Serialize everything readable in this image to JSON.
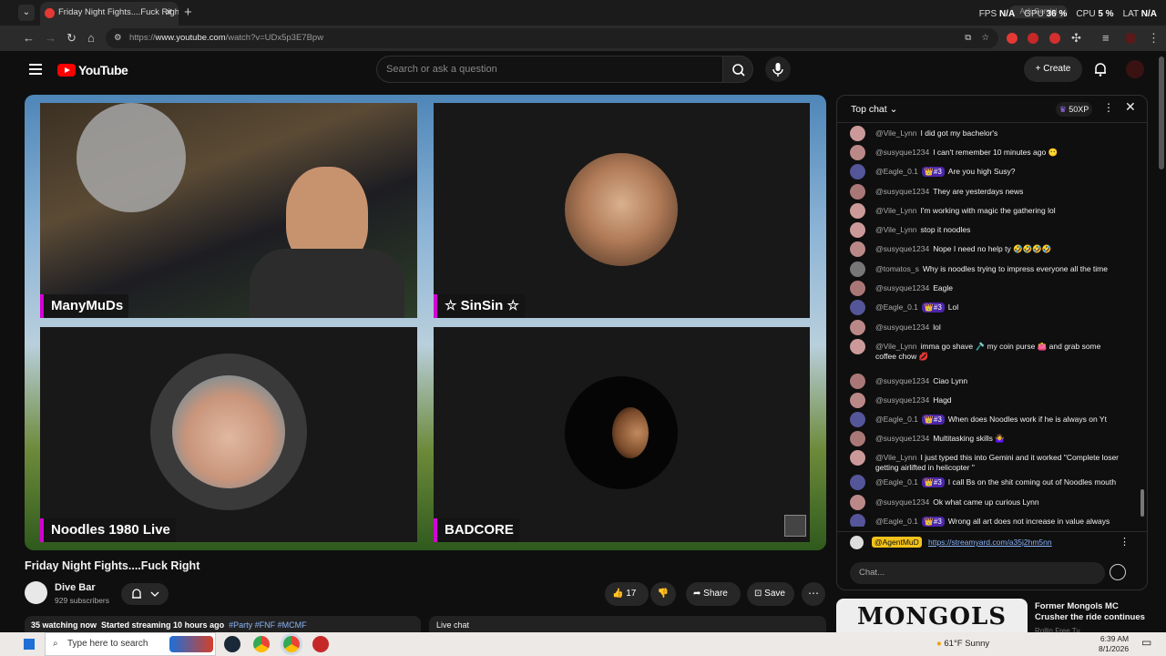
{
  "browser": {
    "tab_title": "Friday Night Fights....Fuck Right",
    "url_prefix": "https://",
    "url_host": "www.youtube.com",
    "url_path": "/watch?v=UDx5p3E7Bpw",
    "ask_gemini": "Ask Gemini",
    "perf": {
      "fps_label": "FPS",
      "fps": "N/A",
      "gpu_label": "GPU",
      "gpu": "36 %",
      "cpu_label": "CPU",
      "cpu": "5 %",
      "lat_label": "LAT",
      "lat": "N/A"
    }
  },
  "header": {
    "logo": "YouTube",
    "search_placeholder": "Search or ask a question",
    "create_label": "Create"
  },
  "video": {
    "participants": [
      {
        "name": "ManyMuDs"
      },
      {
        "name": "☆ SinSin ☆"
      },
      {
        "name": "Noodles 1980 Live"
      },
      {
        "name": "BADCORE"
      }
    ]
  },
  "info": {
    "title": "Friday Night Fights....Fuck Right",
    "channel": "Dive Bar",
    "subscribers": "929 subscribers",
    "likes": "17",
    "share_label": "Share",
    "save_label": "Save",
    "watching": "35 watching now",
    "started": "Started streaming 10 hours ago",
    "tags": "#Party #FNF #MCMF",
    "live_chat_label": "Live chat"
  },
  "chat": {
    "mode": "Top chat",
    "xp": "50XP",
    "messages": [
      {
        "author": "@Vile_Lynn",
        "text": "I did got my bachelor's"
      },
      {
        "author": "@susyque1234",
        "text": "I can't remember 10 minutes ago 😶"
      },
      {
        "author": "@Eagle_0.1",
        "badge": "👑#3",
        "text": "Are you high Susy?"
      },
      {
        "author": "@susyque1234",
        "text": "They are yesterdays news"
      },
      {
        "author": "@Vile_Lynn",
        "text": "I'm working with magic the gathering lol"
      },
      {
        "author": "@Vile_Lynn",
        "text": "stop it noodles"
      },
      {
        "author": "@susyque1234",
        "text": "Nope I need no help ty 🤣🤣🤣🤣"
      },
      {
        "author": "@tomatos_s",
        "text": "Why is noodles trying to impress everyone all the time"
      },
      {
        "author": "@susyque1234",
        "text": "Eagle"
      },
      {
        "author": "@Eagle_0.1",
        "badge": "👑#3",
        "text": "Lol"
      },
      {
        "author": "@susyque1234",
        "text": "lol"
      },
      {
        "author": "@Vile_Lynn",
        "text": "imma go shave 🪒 my coin purse 👛 and grab some coffee chow 💋"
      },
      {
        "author": "@susyque1234",
        "text": "Ciao Lynn"
      },
      {
        "author": "@susyque1234",
        "text": "Hagd"
      },
      {
        "author": "@Eagle_0.1",
        "badge": "👑#3",
        "text": "When does Noodles work if he is always on Yt"
      },
      {
        "author": "@susyque1234",
        "text": "Multitasking skills 🤷‍♀️"
      },
      {
        "author": "@Vile_Lynn",
        "text": "I just typed this into Gemini and it worked \"Complete loser getting airlifted in helicopter \""
      },
      {
        "author": "@Eagle_0.1",
        "badge": "👑#3",
        "text": "I call Bs on the shit coming out of Noodles mouth"
      },
      {
        "author": "@susyque1234",
        "text": "Ok what came up curious Lynn"
      },
      {
        "author": "@Eagle_0.1",
        "badge": "👑#3",
        "text": "Wrong all art does not increase in value always"
      }
    ],
    "pinned_author": "@AgentMuD",
    "pinned_link": "https://streamyard.com/a35j2hm5nn",
    "input_placeholder": "Chat..."
  },
  "recommendation": {
    "thumb_text": "MONGOLS",
    "title": "Former Mongols MC Crusher the ride continues",
    "channel": "Rollin Free Tv"
  },
  "taskbar": {
    "search_placeholder": "Type here to search",
    "weather": "61°F  Sunny",
    "time": "6:39 AM",
    "date": "8/1/2026"
  },
  "colors": {
    "accent_red": "#ff0000",
    "name_bar": "#d400d4",
    "link": "#8ab4f8"
  }
}
